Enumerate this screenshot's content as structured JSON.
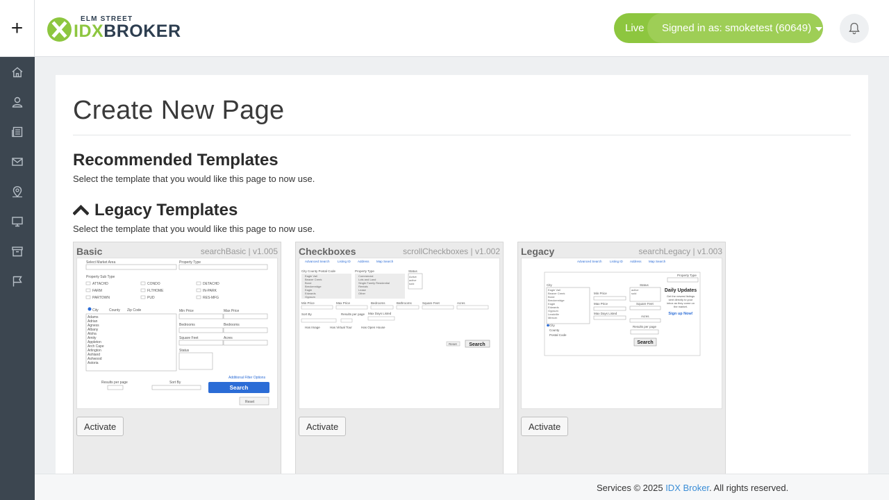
{
  "header": {
    "plus_label": "+",
    "logo_small": "ELM STREET",
    "logo_idx": "IDX",
    "logo_broker": "BROKER",
    "live_label": "Live",
    "signed_in_label": "Signed in as: smoketest (60649)",
    "accent_color": "#8dc63f"
  },
  "sidebar": {
    "items": [
      {
        "icon": "home-icon"
      },
      {
        "icon": "user-icon"
      },
      {
        "icon": "newspaper-icon"
      },
      {
        "icon": "mail-icon"
      },
      {
        "icon": "map-pin-icon"
      },
      {
        "icon": "desktop-icon"
      },
      {
        "icon": "archive-icon"
      },
      {
        "icon": "flag-icon"
      }
    ]
  },
  "page": {
    "title": "Create New Page",
    "recommended_heading": "Recommended Templates",
    "recommended_desc": "Select the template that you would like this page to now use.",
    "legacy_heading": "Legacy Templates",
    "legacy_desc": "Select the template that you would like this page to now use."
  },
  "templates": [
    {
      "name": "Basic",
      "meta": "searchBasic | v1.005",
      "button": "Activate"
    },
    {
      "name": "Checkboxes",
      "meta": "scrollCheckboxes | v1.002",
      "button": "Activate"
    },
    {
      "name": "Legacy",
      "meta": "searchLegacy | v1.003",
      "button": "Activate"
    }
  ],
  "footer": {
    "prefix": "Services © 2025 ",
    "link": "IDX Broker",
    "suffix": ". All rights reserved."
  }
}
